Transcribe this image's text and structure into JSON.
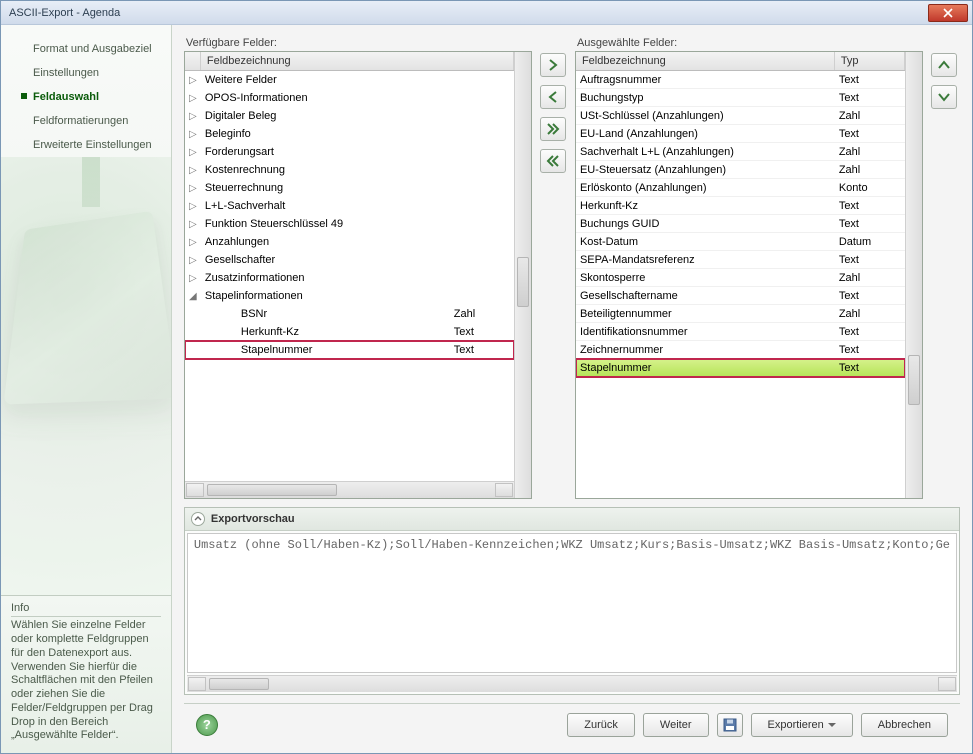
{
  "window": {
    "title": "ASCII-Export - Agenda"
  },
  "nav": {
    "items": [
      {
        "label": "Format und Ausgabeziel"
      },
      {
        "label": "Einstellungen"
      },
      {
        "label": "Feldauswahl"
      },
      {
        "label": "Feldformatierungen"
      },
      {
        "label": "Erweiterte Einstellungen"
      }
    ],
    "activeIndex": 2
  },
  "info": {
    "heading": "Info",
    "text": "Wählen Sie einzelne Felder oder komplette Feldgruppen für den Datenexport aus.\nVerwenden Sie hierfür die Schaltflächen mit den Pfeilen oder ziehen Sie die Felder/Feldgruppen per Drag  Drop in den Bereich „Ausgewählte Felder“."
  },
  "available": {
    "label": "Verfügbare Felder:",
    "header": "Feldbezeichnung",
    "rows": [
      {
        "kind": "group",
        "label": "Weitere Felder"
      },
      {
        "kind": "group",
        "label": "OPOS-Informationen"
      },
      {
        "kind": "group",
        "label": "Digitaler Beleg"
      },
      {
        "kind": "group",
        "label": "Beleginfo"
      },
      {
        "kind": "group",
        "label": "Forderungsart"
      },
      {
        "kind": "group",
        "label": "Kostenrechnung"
      },
      {
        "kind": "group",
        "label": "Steuerrechnung"
      },
      {
        "kind": "group",
        "label": "L+L-Sachverhalt"
      },
      {
        "kind": "group",
        "label": "Funktion Steuerschlüssel 49"
      },
      {
        "kind": "group",
        "label": "Anzahlungen"
      },
      {
        "kind": "group",
        "label": "Gesellschafter"
      },
      {
        "kind": "group",
        "label": "Zusatzinformationen"
      },
      {
        "kind": "group-open",
        "label": "Stapelinformationen"
      },
      {
        "kind": "child",
        "label": "BSNr",
        "type": "Zahl"
      },
      {
        "kind": "child",
        "label": "Herkunft-Kz",
        "type": "Text"
      },
      {
        "kind": "child",
        "label": "Stapelnummer",
        "type": "Text",
        "highlight": true
      }
    ]
  },
  "selected": {
    "label": "Ausgewählte Felder:",
    "header_name": "Feldbezeichnung",
    "header_type": "Typ",
    "rows": [
      {
        "label": "Auftragsnummer",
        "type": "Text"
      },
      {
        "label": "Buchungstyp",
        "type": "Text"
      },
      {
        "label": "USt-Schlüssel (Anzahlungen)",
        "type": "Zahl"
      },
      {
        "label": "EU-Land (Anzahlungen)",
        "type": "Text"
      },
      {
        "label": "Sachverhalt L+L (Anzahlungen)",
        "type": "Zahl"
      },
      {
        "label": "EU-Steuersatz (Anzahlungen)",
        "type": "Zahl"
      },
      {
        "label": "Erlöskonto (Anzahlungen)",
        "type": "Konto"
      },
      {
        "label": "Herkunft-Kz",
        "type": "Text"
      },
      {
        "label": "Buchungs GUID",
        "type": "Text"
      },
      {
        "label": "Kost-Datum",
        "type": "Datum"
      },
      {
        "label": "SEPA-Mandatsreferenz",
        "type": "Text"
      },
      {
        "label": "Skontosperre",
        "type": "Zahl"
      },
      {
        "label": "Gesellschaftername",
        "type": "Text"
      },
      {
        "label": "Beteiligtennummer",
        "type": "Zahl"
      },
      {
        "label": "Identifikationsnummer",
        "type": "Text"
      },
      {
        "label": "Zeichnernummer",
        "type": "Text"
      },
      {
        "label": "Stapelnummer",
        "type": "Text",
        "highlight": true
      }
    ]
  },
  "preview": {
    "title": "Exportvorschau",
    "text": "Umsatz (ohne Soll/Haben-Kz);Soll/Haben-Kennzeichen;WKZ Umsatz;Kurs;Basis-Umsatz;WKZ Basis-Umsatz;Konto;Ge"
  },
  "footer": {
    "back": "Zurück",
    "next": "Weiter",
    "export": "Exportieren",
    "cancel": "Abbrechen"
  }
}
